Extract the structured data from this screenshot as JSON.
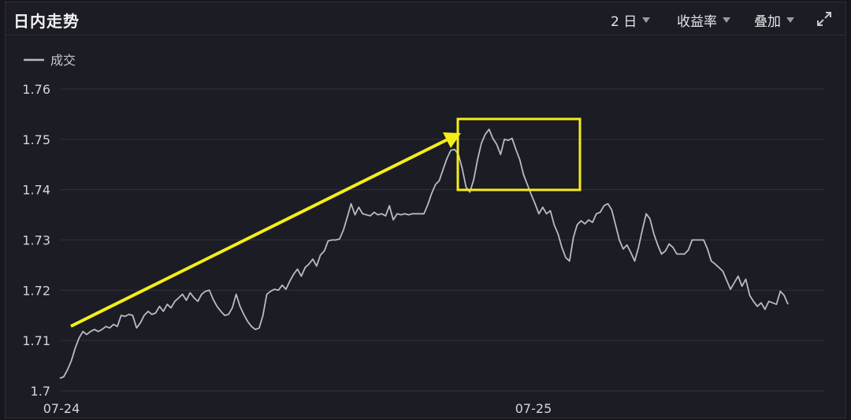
{
  "header": {
    "title": "日内走势",
    "period_label": "2 日",
    "metric_label": "收益率",
    "overlay_label": "叠加"
  },
  "icons": {
    "expand": "expand-icon",
    "caret": "chevron-down-icon"
  },
  "colors": {
    "background": "#1b1c24",
    "line": "#b8bac4",
    "grid": "#30313a",
    "annotation": "#f5ee18"
  },
  "chart_data": {
    "type": "line",
    "legend": [
      "成交"
    ],
    "legend_position": "top-left",
    "grid": true,
    "ylim": [
      1.7,
      1.76
    ],
    "yticks": [
      "1.76",
      "1.75",
      "1.74",
      "1.73",
      "1.72",
      "1.71",
      "1.7"
    ],
    "xticks": [
      "07-24",
      "07-25"
    ],
    "series": [
      {
        "name": "成交",
        "points": [
          [
            0,
            1.7025
          ],
          [
            2,
            1.7028
          ],
          [
            4,
            1.7042
          ],
          [
            6,
            1.706
          ],
          [
            8,
            1.7085
          ],
          [
            10,
            1.7105
          ],
          [
            12,
            1.7118
          ],
          [
            14,
            1.7112
          ],
          [
            16,
            1.7118
          ],
          [
            18,
            1.7122
          ],
          [
            20,
            1.7118
          ],
          [
            22,
            1.7122
          ],
          [
            24,
            1.7128
          ],
          [
            26,
            1.7125
          ],
          [
            28,
            1.7132
          ],
          [
            30,
            1.7128
          ],
          [
            32,
            1.715
          ],
          [
            34,
            1.7148
          ],
          [
            36,
            1.7152
          ],
          [
            38,
            1.715
          ],
          [
            40,
            1.7125
          ],
          [
            42,
            1.7135
          ],
          [
            44,
            1.715
          ],
          [
            46,
            1.7158
          ],
          [
            48,
            1.7152
          ],
          [
            50,
            1.7155
          ],
          [
            52,
            1.7168
          ],
          [
            54,
            1.7158
          ],
          [
            56,
            1.7172
          ],
          [
            58,
            1.7165
          ],
          [
            60,
            1.7178
          ],
          [
            62,
            1.7185
          ],
          [
            64,
            1.7192
          ],
          [
            66,
            1.718
          ],
          [
            68,
            1.7195
          ],
          [
            70,
            1.7185
          ],
          [
            72,
            1.7178
          ],
          [
            74,
            1.7192
          ],
          [
            76,
            1.7198
          ],
          [
            78,
            1.72
          ],
          [
            80,
            1.7182
          ],
          [
            82,
            1.7168
          ],
          [
            84,
            1.7158
          ],
          [
            86,
            1.715
          ],
          [
            88,
            1.7152
          ],
          [
            90,
            1.7165
          ],
          [
            92,
            1.7192
          ],
          [
            94,
            1.7168
          ],
          [
            96,
            1.7152
          ],
          [
            98,
            1.7138
          ],
          [
            100,
            1.7128
          ],
          [
            102,
            1.7122
          ],
          [
            104,
            1.7125
          ],
          [
            106,
            1.715
          ],
          [
            108,
            1.7192
          ],
          [
            110,
            1.7198
          ],
          [
            112,
            1.7202
          ],
          [
            114,
            1.72
          ],
          [
            116,
            1.721
          ],
          [
            118,
            1.7202
          ],
          [
            120,
            1.7218
          ],
          [
            122,
            1.7232
          ],
          [
            124,
            1.7242
          ],
          [
            126,
            1.7228
          ],
          [
            128,
            1.7245
          ],
          [
            130,
            1.7252
          ],
          [
            132,
            1.7262
          ],
          [
            134,
            1.7248
          ],
          [
            136,
            1.727
          ],
          [
            138,
            1.7278
          ],
          [
            140,
            1.7298
          ],
          [
            142,
            1.73
          ],
          [
            144,
            1.73
          ],
          [
            146,
            1.7302
          ],
          [
            148,
            1.732
          ],
          [
            150,
            1.7345
          ],
          [
            152,
            1.7372
          ],
          [
            154,
            1.735
          ],
          [
            156,
            1.7365
          ],
          [
            158,
            1.7352
          ],
          [
            160,
            1.735
          ],
          [
            162,
            1.7348
          ],
          [
            164,
            1.7355
          ],
          [
            166,
            1.735
          ],
          [
            168,
            1.7352
          ],
          [
            170,
            1.7348
          ],
          [
            172,
            1.7368
          ],
          [
            174,
            1.734
          ],
          [
            176,
            1.7352
          ],
          [
            178,
            1.735
          ],
          [
            180,
            1.7352
          ],
          [
            182,
            1.735
          ],
          [
            184,
            1.7352
          ],
          [
            186,
            1.7352
          ],
          [
            188,
            1.7352
          ],
          [
            190,
            1.7352
          ],
          [
            192,
            1.737
          ],
          [
            194,
            1.7392
          ],
          [
            196,
            1.741
          ],
          [
            198,
            1.7418
          ],
          [
            200,
            1.744
          ],
          [
            202,
            1.7462
          ],
          [
            204,
            1.7478
          ],
          [
            206,
            1.748
          ],
          [
            208,
            1.747
          ],
          [
            210,
            1.7442
          ],
          [
            212,
            1.7405
          ],
          [
            214,
            1.7395
          ],
          [
            216,
            1.742
          ],
          [
            218,
            1.746
          ],
          [
            220,
            1.7492
          ],
          [
            222,
            1.751
          ],
          [
            224,
            1.752
          ],
          [
            226,
            1.7502
          ],
          [
            228,
            1.749
          ],
          [
            230,
            1.747
          ],
          [
            232,
            1.75
          ],
          [
            234,
            1.7498
          ],
          [
            236,
            1.7502
          ],
          [
            238,
            1.748
          ],
          [
            240,
            1.746
          ],
          [
            242,
            1.743
          ],
          [
            244,
            1.741
          ],
          [
            246,
            1.739
          ],
          [
            248,
            1.7372
          ],
          [
            250,
            1.7352
          ],
          [
            252,
            1.7365
          ],
          [
            254,
            1.7352
          ],
          [
            256,
            1.7358
          ],
          [
            258,
            1.733
          ],
          [
            260,
            1.7312
          ],
          [
            262,
            1.7285
          ],
          [
            264,
            1.7265
          ],
          [
            266,
            1.7258
          ],
          [
            268,
            1.7305
          ],
          [
            270,
            1.733
          ],
          [
            272,
            1.7338
          ],
          [
            274,
            1.7332
          ],
          [
            276,
            1.734
          ],
          [
            278,
            1.7335
          ],
          [
            280,
            1.7352
          ],
          [
            282,
            1.7355
          ],
          [
            284,
            1.7368
          ],
          [
            286,
            1.7372
          ],
          [
            288,
            1.736
          ],
          [
            290,
            1.733
          ],
          [
            292,
            1.73
          ],
          [
            294,
            1.7282
          ],
          [
            296,
            1.729
          ],
          [
            298,
            1.7275
          ],
          [
            300,
            1.7258
          ],
          [
            302,
            1.7285
          ],
          [
            304,
            1.732
          ],
          [
            306,
            1.7352
          ],
          [
            308,
            1.7342
          ],
          [
            310,
            1.7312
          ],
          [
            312,
            1.729
          ],
          [
            314,
            1.7272
          ],
          [
            316,
            1.7278
          ],
          [
            318,
            1.7292
          ],
          [
            320,
            1.7285
          ],
          [
            322,
            1.7272
          ],
          [
            324,
            1.7272
          ],
          [
            326,
            1.7272
          ],
          [
            328,
            1.728
          ],
          [
            330,
            1.73
          ],
          [
            332,
            1.73
          ],
          [
            334,
            1.73
          ],
          [
            336,
            1.73
          ],
          [
            338,
            1.7282
          ],
          [
            340,
            1.7258
          ],
          [
            342,
            1.7252
          ],
          [
            344,
            1.7245
          ],
          [
            346,
            1.7238
          ],
          [
            348,
            1.722
          ],
          [
            350,
            1.7202
          ],
          [
            352,
            1.7215
          ],
          [
            354,
            1.7228
          ],
          [
            356,
            1.7208
          ],
          [
            358,
            1.7222
          ],
          [
            360,
            1.719
          ],
          [
            362,
            1.7178
          ],
          [
            364,
            1.7168
          ],
          [
            366,
            1.7175
          ],
          [
            368,
            1.7162
          ],
          [
            370,
            1.7178
          ],
          [
            372,
            1.7175
          ],
          [
            374,
            1.7172
          ],
          [
            376,
            1.7198
          ],
          [
            378,
            1.719
          ],
          [
            380,
            1.7172
          ]
        ]
      }
    ]
  }
}
